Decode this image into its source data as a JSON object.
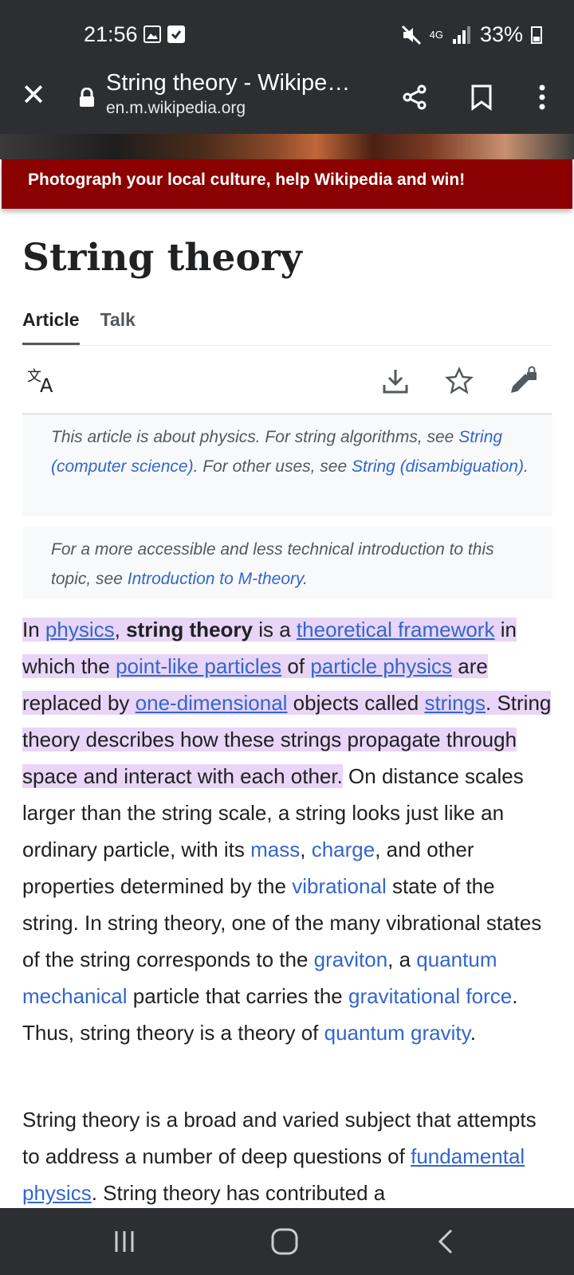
{
  "status_bar": {
    "time": "21:56",
    "network": "4G",
    "battery": "33%",
    "icons": [
      "gallery-icon",
      "check-icon",
      "mute-icon",
      "signal-icon",
      "battery-icon"
    ]
  },
  "browser": {
    "page_title": "String theory - Wikipe…",
    "url": "en.m.wikipedia.org",
    "icons": [
      "close-icon",
      "lock-icon",
      "share-icon",
      "bookmark-icon",
      "more-icon"
    ]
  },
  "banner": {
    "text": "Photograph your local culture, help Wikipedia and win!"
  },
  "article": {
    "title": "String theory",
    "tabs": [
      {
        "label": "Article",
        "active": true
      },
      {
        "label": "Talk",
        "active": false
      }
    ],
    "actions": [
      "language-icon",
      "download-icon",
      "star-icon",
      "edit-lock-icon"
    ],
    "hatnote1": {
      "t1": "This article is about physics. For string algorithms, see ",
      "l1": "String (computer science)",
      "t2": ". For other uses, see ",
      "l2": "String (disambiguation)",
      "t3": "."
    },
    "hatnote2": {
      "t1": "For a more accessible and less technical introduction to this topic, see ",
      "l1": "Introduction to M-theory",
      "t2": "."
    },
    "para1": {
      "s1": "In ",
      "l_physics": "physics",
      "s2": ", ",
      "bold": "string theory",
      "s3": " is a ",
      "l_framework": "theoretical framework",
      "s4": " in which the ",
      "l_pointlike": "point-like particles",
      "s5": " of ",
      "l_particle_physics": "particle physics",
      "s6": " are replaced by ",
      "l_onedim": "one-dimensional",
      "s7": " objects called ",
      "l_strings": "strings",
      "s8": ". String theory describes how these strings propagate through space and interact with each other.",
      "s9": " On distance scales larger than the string scale, a string looks just like an ordinary particle, with its ",
      "l_mass": "mass",
      "s10": ", ",
      "l_charge": "charge",
      "s11": ", and other properties determined by the ",
      "l_vibrational": "vibrational",
      "s12": " state of the string. In string theory, one of the many vibrational states of the string corresponds to the ",
      "l_graviton": "graviton",
      "s13": ", a ",
      "l_qm": "quantum mechanical",
      "s14": " particle that carries the ",
      "l_gforce": "gravitational force",
      "s15": ". Thus, string theory is a theory of ",
      "l_qg": "quantum gravity",
      "s16": "."
    },
    "para2": {
      "s1": "String theory is a broad and varied subject that attempts to address a number of deep questions of ",
      "l_fundamental": "fundamental physics",
      "s2": ". String theory has contributed a"
    }
  },
  "nav": {
    "icons": [
      "recents-icon",
      "home-icon",
      "back-icon"
    ]
  },
  "colors": {
    "chrome": "#2d2e31",
    "banner": "#8b0000",
    "link": "#3366cc",
    "highlight": "#e8d5f7"
  }
}
